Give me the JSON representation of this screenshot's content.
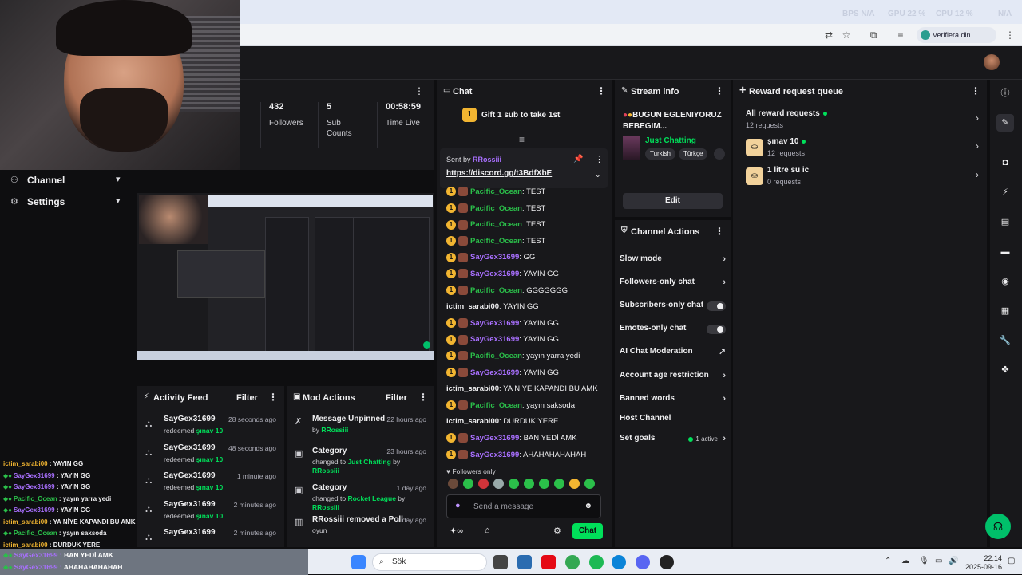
{
  "browser": {
    "perf": {
      "bps": "BPS N/A",
      "gpu": "GPU 22 %",
      "cpu": "CPU 12 %",
      "na": "N/A"
    },
    "identity_label": "Verifiera din identitet"
  },
  "left_nav": {
    "items": [
      {
        "label": "Channel",
        "icon": "channel-icon"
      },
      {
        "label": "Settings",
        "icon": "gear-icon"
      }
    ]
  },
  "stats": [
    {
      "value": "432",
      "label": "Followers"
    },
    {
      "value": "5",
      "label": "Sub Counts"
    },
    {
      "value": "00:58:59",
      "label": "Time Live"
    }
  ],
  "chat": {
    "title": "Chat",
    "gift_text": "Gift 1 sub to take 1st",
    "gift_badge": "1",
    "pinned": {
      "sent_by_label": "Sent by",
      "sender": "RRossiii",
      "link": "https://discord.gg/t3BdfXbE"
    },
    "messages": [
      {
        "user": "Pacific_Ocean",
        "text": "TEST",
        "color": "#2bbf4a",
        "badges": true
      },
      {
        "user": "Pacific_Ocean",
        "text": "TEST",
        "color": "#2bbf4a",
        "badges": true
      },
      {
        "user": "Pacific_Ocean",
        "text": "TEST",
        "color": "#2bbf4a",
        "badges": true
      },
      {
        "user": "Pacific_Ocean",
        "text": "TEST",
        "color": "#2bbf4a",
        "badges": true
      },
      {
        "user": "SayGex31699",
        "text": "GG",
        "color": "#a970ff",
        "badges": true
      },
      {
        "user": "SayGex31699",
        "text": "YAYIN GG",
        "color": "#a970ff",
        "badges": true
      },
      {
        "user": "Pacific_Ocean",
        "text": "GGGGGGG",
        "color": "#2bbf4a",
        "badges": true
      },
      {
        "user": "ictim_sarabi00",
        "text": "YAYIN GG",
        "color": "#efeff1",
        "badges": false
      },
      {
        "user": "SayGex31699",
        "text": "YAYIN GG",
        "color": "#a970ff",
        "badges": true
      },
      {
        "user": "SayGex31699",
        "text": "YAYIN GG",
        "color": "#a970ff",
        "badges": true
      },
      {
        "user": "Pacific_Ocean",
        "text": "yayın yarra yedi",
        "color": "#2bbf4a",
        "badges": true
      },
      {
        "user": "SayGex31699",
        "text": "YAYIN GG",
        "color": "#a970ff",
        "badges": true
      },
      {
        "user": "ictim_sarabi00",
        "text": "YA NİYE KAPANDI BU AMK",
        "color": "#efeff1",
        "badges": false
      },
      {
        "user": "Pacific_Ocean",
        "text": "yayın saksoda",
        "color": "#2bbf4a",
        "badges": true
      },
      {
        "user": "ictim_sarabi00",
        "text": "DURDUK YERE",
        "color": "#efeff1",
        "badges": false
      },
      {
        "user": "SayGex31699",
        "text": "BAN YEDİ AMK",
        "color": "#a970ff",
        "badges": true
      },
      {
        "user": "SayGex31699",
        "text": "AHAHAHAHAHAH",
        "color": "#a970ff",
        "badges": true
      }
    ],
    "followers_only": "Followers only",
    "input_placeholder": "Send a message",
    "send_label": "Chat"
  },
  "stream_info": {
    "title_header": "Stream info",
    "stream_title": "BUGUN EGLENIYORUZ BEBEGIM...",
    "category": "Just Chatting",
    "tags": [
      "Turkish",
      "Türkçe"
    ],
    "edit_label": "Edit"
  },
  "channel_actions": {
    "title": "Channel Actions",
    "rows": [
      {
        "label": "Slow mode",
        "kind": "chevron"
      },
      {
        "label": "Followers-only chat",
        "kind": "chevron"
      },
      {
        "label": "Subscribers-only chat",
        "kind": "toggle"
      },
      {
        "label": "Emotes-only chat",
        "kind": "toggle"
      },
      {
        "label": "AI Chat Moderation",
        "kind": "external"
      },
      {
        "label": "Account age restriction",
        "kind": "chevron"
      },
      {
        "label": "Banned words",
        "kind": "chevron"
      },
      {
        "label": "Host Channel",
        "kind": "none"
      },
      {
        "label": "Set goals",
        "kind": "active",
        "badge": "1 active"
      }
    ]
  },
  "rewards": {
    "title": "Reward request queue",
    "all": {
      "label": "All reward requests",
      "count": "12 requests"
    },
    "items": [
      {
        "label": "şınav 10",
        "count": "12 requests",
        "active": true
      },
      {
        "label": "1 litre su ic",
        "count": "0 requests",
        "active": false
      }
    ]
  },
  "activity_feed": {
    "title": "Activity Feed",
    "filter_label": "Filter",
    "items": [
      {
        "user": "SayGex31699",
        "time": "28 seconds ago",
        "action": "redeemed",
        "reward": "şınav 10"
      },
      {
        "user": "SayGex31699",
        "time": "48 seconds ago",
        "action": "redeemed",
        "reward": "şınav 10"
      },
      {
        "user": "SayGex31699",
        "time": "1 minute ago",
        "action": "redeemed",
        "reward": "şınav 10"
      },
      {
        "user": "SayGex31699",
        "time": "2 minutes ago",
        "action": "redeemed",
        "reward": "şınav 10"
      },
      {
        "user": "SayGex31699",
        "time": "2 minutes ago",
        "action": "",
        "reward": ""
      }
    ]
  },
  "mod_actions": {
    "title": "Mod Actions",
    "filter_label": "Filter",
    "items": [
      {
        "title": "Message Unpinned",
        "time": "22 hours ago",
        "pre": "by",
        "hl": "RRossiii",
        "mid": "",
        "hl2": ""
      },
      {
        "title": "Category",
        "time": "23 hours ago",
        "pre": "changed to",
        "hl": "Just Chatting",
        "mid": "by",
        "hl2": "RRossiii"
      },
      {
        "title": "Category",
        "time": "1 day ago",
        "pre": "changed to",
        "hl": "Rocket League",
        "mid": "by",
        "hl2": "RRossiii"
      },
      {
        "title": "RRossiii removed a Poll",
        "time": "1 day ago",
        "pre": "oyun",
        "hl": "",
        "mid": "",
        "hl2": ""
      }
    ]
  },
  "overlay_chat": [
    {
      "user": "ictim_sarabi00",
      "text": "YAYIN GG",
      "color": "#f2b531",
      "badges": false
    },
    {
      "user": "SayGex31699",
      "text": "YAYIN GG",
      "color": "#a970ff",
      "badges": true
    },
    {
      "user": "SayGex31699",
      "text": "YAYIN GG",
      "color": "#a970ff",
      "badges": true
    },
    {
      "user": "Pacific_Ocean",
      "text": "yayın yarra yedi",
      "color": "#2bbf4a",
      "badges": true
    },
    {
      "user": "SayGex31699",
      "text": "YAYIN GG",
      "color": "#a970ff",
      "badges": true
    },
    {
      "user": "ictim_sarabi00",
      "text": "YA NİYE KAPANDI BU AMK",
      "color": "#f2b531",
      "badges": false
    },
    {
      "user": "Pacific_Ocean",
      "text": "yayın saksoda",
      "color": "#2bbf4a",
      "badges": true
    },
    {
      "user": "ictim_sarabi00",
      "text": "DURDUK YERE",
      "color": "#f2b531",
      "badges": false
    }
  ],
  "taskbar": {
    "overlay_lines": [
      {
        "user": "SayGex31699",
        "text": "BAN YEDİ AMK"
      },
      {
        "user": "SayGex31699",
        "text": "AHAHAHAHAHAH"
      }
    ],
    "search_label": "Sök",
    "time": "22:14",
    "date": "2025-09-16"
  },
  "colors": {
    "accent": "#00e05a",
    "purple": "#a970ff",
    "gold": "#f2b531",
    "bg": "#0e0e10",
    "panel": "#18181b"
  }
}
